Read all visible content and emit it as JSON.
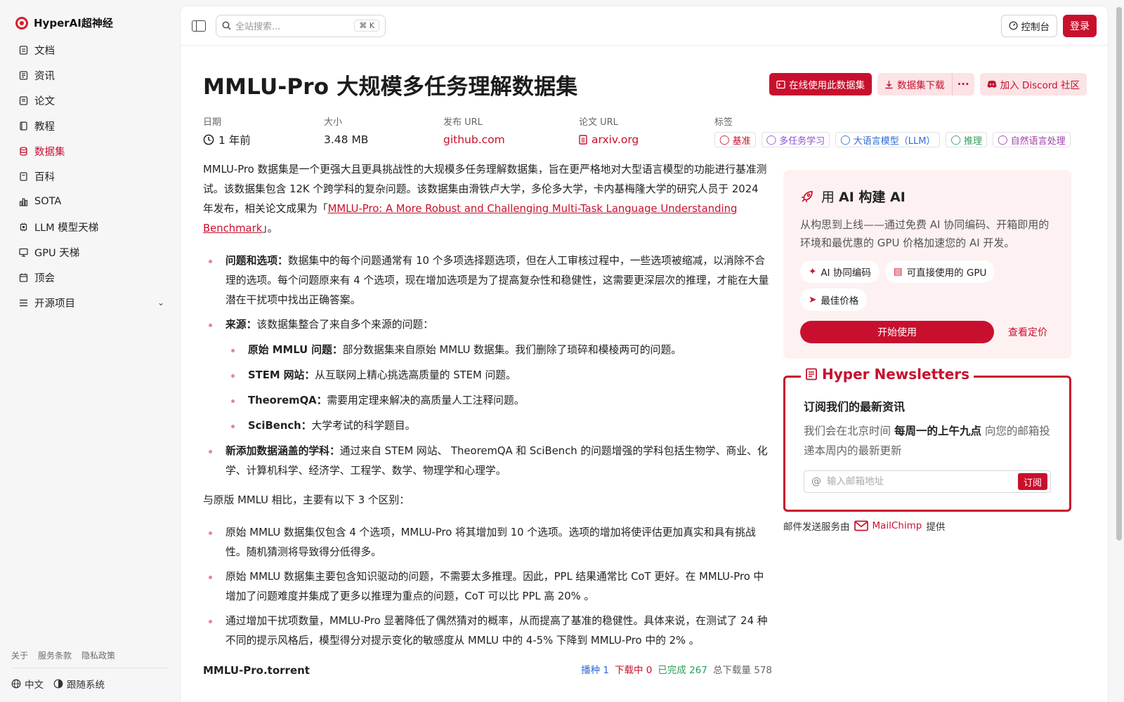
{
  "brand": {
    "name": "HyperAI超神经"
  },
  "sidebar": {
    "items": [
      {
        "label": "文档",
        "icon": "doc-icon"
      },
      {
        "label": "资讯",
        "icon": "news-icon"
      },
      {
        "label": "论文",
        "icon": "paper-icon"
      },
      {
        "label": "教程",
        "icon": "book-icon"
      },
      {
        "label": "数据集",
        "icon": "database-icon"
      },
      {
        "label": "百科",
        "icon": "book-icon"
      },
      {
        "label": "SOTA",
        "icon": "chart-icon"
      },
      {
        "label": "LLM 模型天梯",
        "icon": "cpu-icon"
      },
      {
        "label": "GPU 天梯",
        "icon": "monitor-icon"
      },
      {
        "label": "顶会",
        "icon": "calendar-icon"
      },
      {
        "label": "开源项目",
        "icon": "list-icon"
      }
    ],
    "footer_links": [
      "关于",
      "服务条款",
      "隐私政策"
    ],
    "language": "中文",
    "theme": "跟随系统"
  },
  "topbar": {
    "search_placeholder": "全站搜索...",
    "shortcut": "K",
    "console_label": "控制台",
    "login_label": "登录"
  },
  "dataset": {
    "title": "MMLU-Pro 大规模多任务理解数据集",
    "actions": {
      "use_online": "在线使用此数据集",
      "download": "数据集下载",
      "more": "···",
      "discord": "加入 Discord 社区"
    },
    "meta": {
      "date_label": "日期",
      "date_value": "1 年前",
      "size_label": "大小",
      "size_value": "3.48 MB",
      "release_label": "发布 URL",
      "release_value": "github.com",
      "paper_label": "论文 URL",
      "paper_value": "arxiv.org",
      "tags_label": "标签",
      "tags": [
        "基准",
        "多任务学习",
        "大语言模型（LLM）",
        "推理",
        "自然语言处理"
      ]
    }
  },
  "article": {
    "intro_before": "MMLU-Pro 数据集是一个更强大且更具挑战性的大规模多任务理解数据集，旨在更严格地对大型语言模型的功能进行基准测试。该数据集包含 12K 个跨学科的复杂问题。该数据集由滑铁卢大学，多伦多大学，卡内基梅隆大学的研究人员于 2024 年发布，相关论文成果为「",
    "intro_link": "MMLU-Pro: A More Robust and Challenging Multi-Task Language Understanding Benchmark",
    "intro_after": "」。",
    "b1_title": "问题和选项：",
    "b1_text": "数据集中的每个问题通常有 10 个多项选择题选项，但在人工审核过程中，一些选项被缩减，以消除不合理的选项。每个问题原来有 4 个选项，现在增加选项是为了提高复杂性和稳健性，这需要更深层次的推理，才能在大量潜在干扰项中找出正确答案。",
    "b2_title": "来源：",
    "b2_text": "该数据集整合了来自多个来源的问题：",
    "sub1_title": "原始 MMLU 问题：",
    "sub1_text": "部分数据集来自原始 MMLU 数据集。我们删除了琐碎和模棱两可的问题。",
    "sub2_title": "STEM 网站：",
    "sub2_text": "从互联网上精心挑选高质量的 STEM 问题。",
    "sub3_title": "TheoremQA：",
    "sub3_text": "需要用定理来解决的高质量人工注释问题。",
    "sub4_title": "SciBench：",
    "sub4_text": "大学考试的科学题目。",
    "b3_title": "新添加数据涵盖的学科：",
    "b3_text": "通过来自 STEM 网站、 TheoremQA 和 SciBench 的问题增强的学科包括生物学、商业、化学、计算机科学、经济学、工程学、数学、物理学和心理学。",
    "compare_intro": "与原版 MMLU 相比，主要有以下 3 个区别：",
    "diff1": "原始 MMLU 数据集仅包含 4 个选项，MMLU-Pro 将其增加到 10 个选项。选项的增加将使评估更加真实和具有挑战性。随机猜测将导致得分低得多。",
    "diff2": "原始 MMLU 数据集主要包含知识驱动的问题，不需要太多推理。因此，PPL 结果通常比 CoT 更好。在 MMLU-Pro 中增加了问题难度并集成了更多以推理为重点的问题，CoT 可以比 PPL 高 20% 。",
    "diff3": "通过增加干扰项数量，MMLU-Pro 显著降低了偶然猜对的概率，从而提高了基准的稳健性。具体来说，在测试了 24 种不同的提示风格后，模型得分对提示变化的敏感度从 MMLU 中的 4-5% 下降到 MMLU-Pro 中的 2% 。",
    "torrent_title": "MMLU-Pro.torrent",
    "seeding": "播种 1",
    "downloading": "下载中 0",
    "completed": "已完成 267",
    "total": "总下载量 578"
  },
  "promo": {
    "title_prefix": "用",
    "title_main": "AI 构建 AI",
    "desc": "从构思到上线——通过免费 AI 协同编码、开箱即用的环境和最优惠的 GPU 价格加速您的 AI 开发。",
    "features": [
      "AI 协同编码",
      "可直接使用的 GPU",
      "最佳价格"
    ],
    "start_label": "开始使用",
    "pricing_label": "查看定价"
  },
  "newsletter": {
    "legend": "Hyper Newsletters",
    "heading": "订阅我们的最新资讯",
    "desc_before": "我们会在北京时间",
    "desc_bold": "每周一的上午九点",
    "desc_after": "向您的邮箱投递本周内的最新更新",
    "placeholder": "输入邮箱地址",
    "subscribe_label": "订阅",
    "credit_prefix": "邮件发送服务由",
    "credit_brand": "MailChimp",
    "credit_suffix": "提供"
  },
  "colors": {
    "accent": "#c8102e",
    "tag_red": "#c8102e",
    "tag_purple": "#8a4fd1",
    "tag_blue": "#2f6bd3",
    "tag_green": "#2e9d5b",
    "tag_violet": "#9b3fa6",
    "stat_blue": "#2f6bd3",
    "stat_red": "#c8102e",
    "stat_green": "#2e9d5b"
  }
}
